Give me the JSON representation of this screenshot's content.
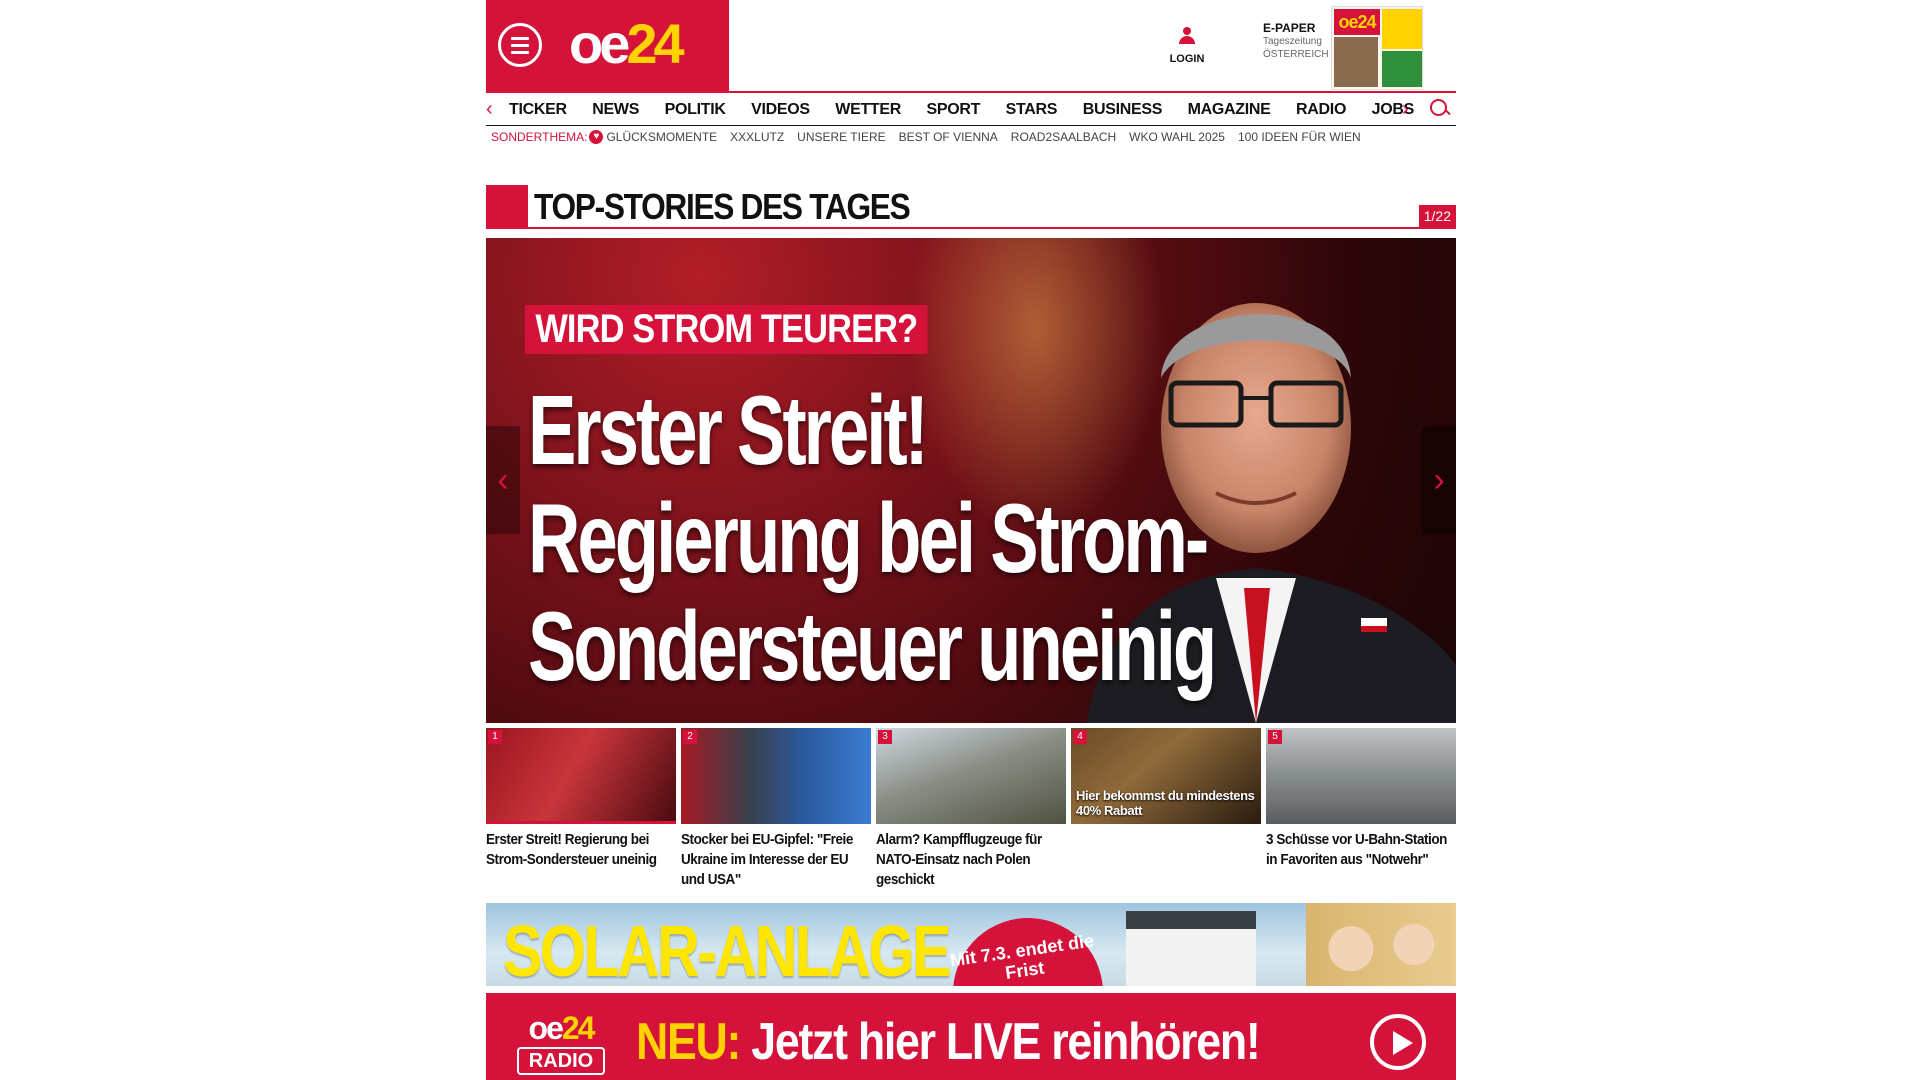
{
  "header": {
    "logo_oe": "oe",
    "logo_24": "24",
    "login_label": "LOGIN",
    "epaper_title": "E-PAPER",
    "epaper_sub1": "Tageszeitung",
    "epaper_sub2": "ÖSTERREICH"
  },
  "nav": {
    "items": [
      "TICKER",
      "NEWS",
      "POLITIK",
      "VIDEOS",
      "WETTER",
      "SPORT",
      "STARS",
      "BUSINESS",
      "MAGAZINE",
      "RADIO",
      "JOBS"
    ]
  },
  "subnav": {
    "label": "SONDERTHEMA:",
    "items": [
      "GLÜCKSMOMENTE",
      "XXXLUTZ",
      "UNSERE TIERE",
      "BEST OF VIENNA",
      "ROAD2SAALBACH",
      "WKO WAHL 2025",
      "100 IDEEN FÜR WIEN"
    ]
  },
  "section": {
    "title": "TOP-STORIES DES TAGES",
    "counter": "1/22"
  },
  "hero": {
    "kicker": "WIRD STROM TEURER?",
    "headline_1": "Erster Streit!",
    "headline_2": "Regierung bei Strom-",
    "headline_3": "Sondersteuer uneinig"
  },
  "thumbs": [
    {
      "num": "1",
      "caption": "Erster Streit! Regierung bei Strom-Sondersteuer uneinig"
    },
    {
      "num": "2",
      "caption": "Stocker bei EU-Gipfel: \"Freie Ukraine im Interesse der EU und USA\""
    },
    {
      "num": "3",
      "caption": "Alarm? Kampfflugzeuge für NATO-Einsatz nach Polen geschickt"
    },
    {
      "num": "4",
      "caption": "",
      "overlay": "Hier bekommst du mindestens 40% Rabatt"
    },
    {
      "num": "5",
      "caption": "3 Schüsse vor U-Bahn-Station in Favoriten aus \"Notwehr\""
    }
  ],
  "banner": {
    "headline": "SOLAR-ANLAGE",
    "badge": "Mit 7.3. endet die Frist"
  },
  "radio": {
    "logo_oe": "oe",
    "logo_24": "24",
    "logo_label": "RADIO",
    "neu": "NEU:",
    "text": " Jetzt hier LIVE reinhören!"
  }
}
